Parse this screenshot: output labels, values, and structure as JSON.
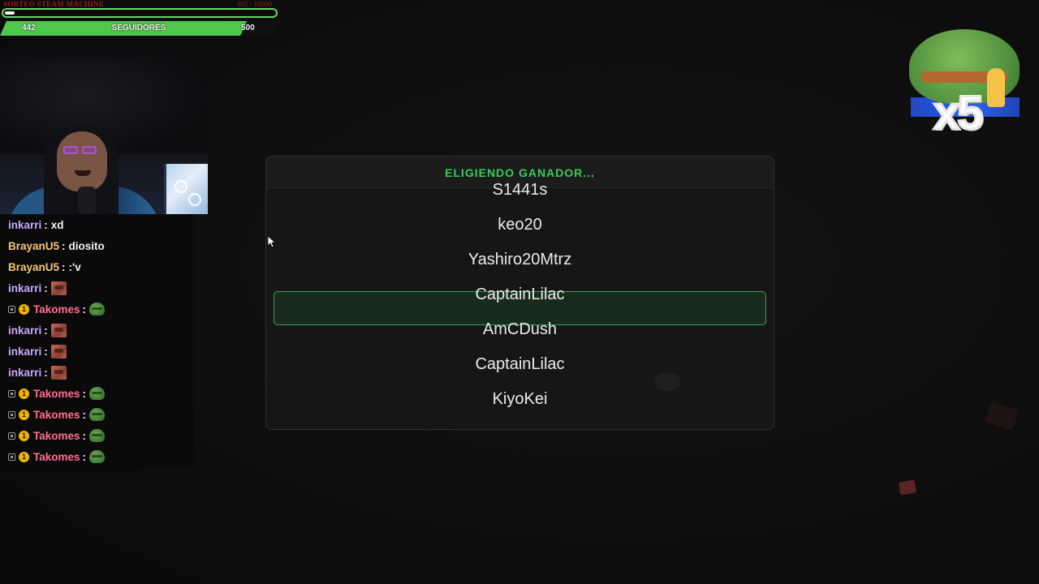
{
  "goal": {
    "title": "SORTEO STEAM MACHINE",
    "count": "002 / 10000",
    "progress_fraction": 0.02
  },
  "followers": {
    "current": "442",
    "label": "SEGUIDORES",
    "goal": "500",
    "progress_fraction": 0.884,
    "color": "#4fc94b"
  },
  "chat": {
    "messages": [
      {
        "user": "inkarri",
        "color": "#c9a7ff",
        "text": "xd",
        "emote": "",
        "badges": false
      },
      {
        "user": "BrayanU5",
        "color": "#f5c67a",
        "text": "diosito",
        "emote": "",
        "badges": false
      },
      {
        "user": "BrayanU5",
        "color": "#f5c67a",
        "text": ":'v",
        "emote": "",
        "badges": false
      },
      {
        "user": "inkarri",
        "color": "#c9a7ff",
        "text": "",
        "emote": "box",
        "badges": false
      },
      {
        "user": "Takomes",
        "color": "#ff6f8e",
        "text": "",
        "emote": "frog",
        "badges": true
      },
      {
        "user": "inkarri",
        "color": "#c9a7ff",
        "text": "",
        "emote": "box",
        "badges": false
      },
      {
        "user": "inkarri",
        "color": "#c9a7ff",
        "text": "",
        "emote": "box",
        "badges": false
      },
      {
        "user": "inkarri",
        "color": "#c9a7ff",
        "text": "",
        "emote": "box",
        "badges": false
      },
      {
        "user": "Takomes",
        "color": "#ff6f8e",
        "text": "",
        "emote": "frog",
        "badges": true
      },
      {
        "user": "Takomes",
        "color": "#ff6f8e",
        "text": "",
        "emote": "frog",
        "badges": true
      },
      {
        "user": "Takomes",
        "color": "#ff6f8e",
        "text": "",
        "emote": "frog",
        "badges": true
      },
      {
        "user": "Takomes",
        "color": "#ff6f8e",
        "text": "",
        "emote": "frog",
        "badges": true
      }
    ],
    "separator": ":",
    "sub_badge_text": "1"
  },
  "emote_combo": {
    "multiplier": "x5",
    "icon": "frog-praying-emote"
  },
  "picker": {
    "title": "ELIGIENDO GANADOR...",
    "title_color": "#38cc5c",
    "entries": [
      "S1441s",
      "keo20",
      "Yashiro20Mtrz",
      "CaptainLilac",
      "AmCDush",
      "CaptainLilac",
      "KiyoKei"
    ],
    "highlighted_index": 3
  }
}
